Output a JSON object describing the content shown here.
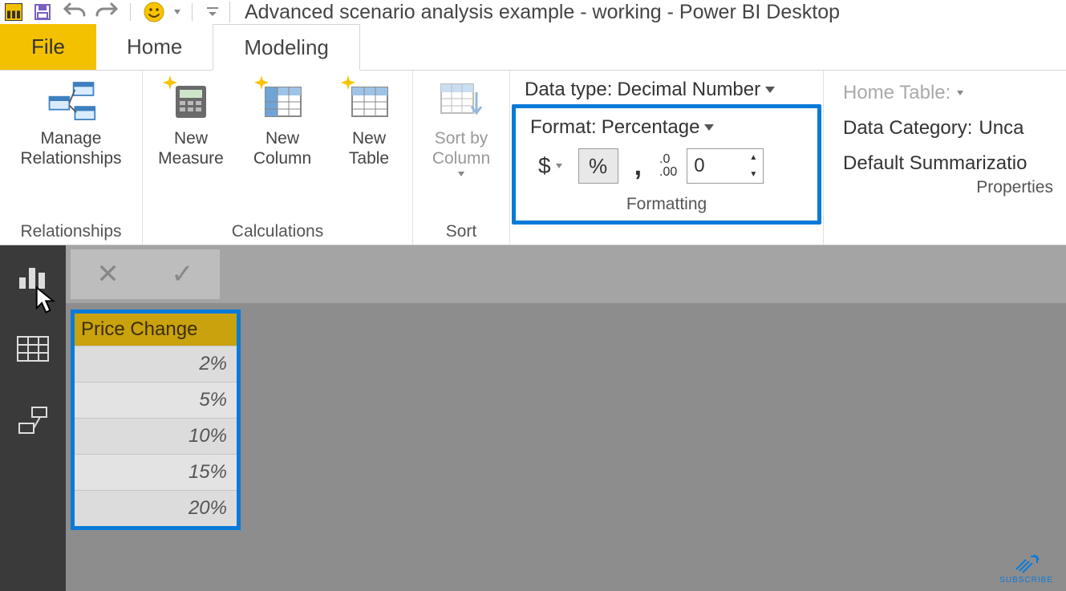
{
  "title": "Advanced scenario analysis example - working - Power BI Desktop",
  "tabs": {
    "file": "File",
    "home": "Home",
    "modeling": "Modeling"
  },
  "ribbon": {
    "relationships": {
      "label": "Relationships",
      "manage": "Manage\nRelationships"
    },
    "calculations": {
      "label": "Calculations",
      "new_measure": "New\nMeasure",
      "new_column": "New\nColumn",
      "new_table": "New\nTable"
    },
    "sort": {
      "label": "Sort",
      "sort_by_column": "Sort by\nColumn"
    },
    "formatting": {
      "label": "Formatting",
      "data_type_label": "Data type:",
      "data_type_value": "Decimal Number",
      "format_label": "Format:",
      "format_value": "Percentage",
      "currency": "$",
      "percent": "%",
      "thousands": ",",
      "decimal_icon": ".0\n.00",
      "decimal_places": "0"
    },
    "properties": {
      "label": "Properties",
      "home_table": "Home Table:",
      "data_category_label": "Data Category:",
      "data_category_value": "Unca",
      "default_summarization": "Default Summarizatio"
    }
  },
  "table": {
    "header": "Price Change",
    "rows": [
      "2%",
      "5%",
      "10%",
      "15%",
      "20%"
    ]
  },
  "subscribe": "SUBSCRIBE"
}
